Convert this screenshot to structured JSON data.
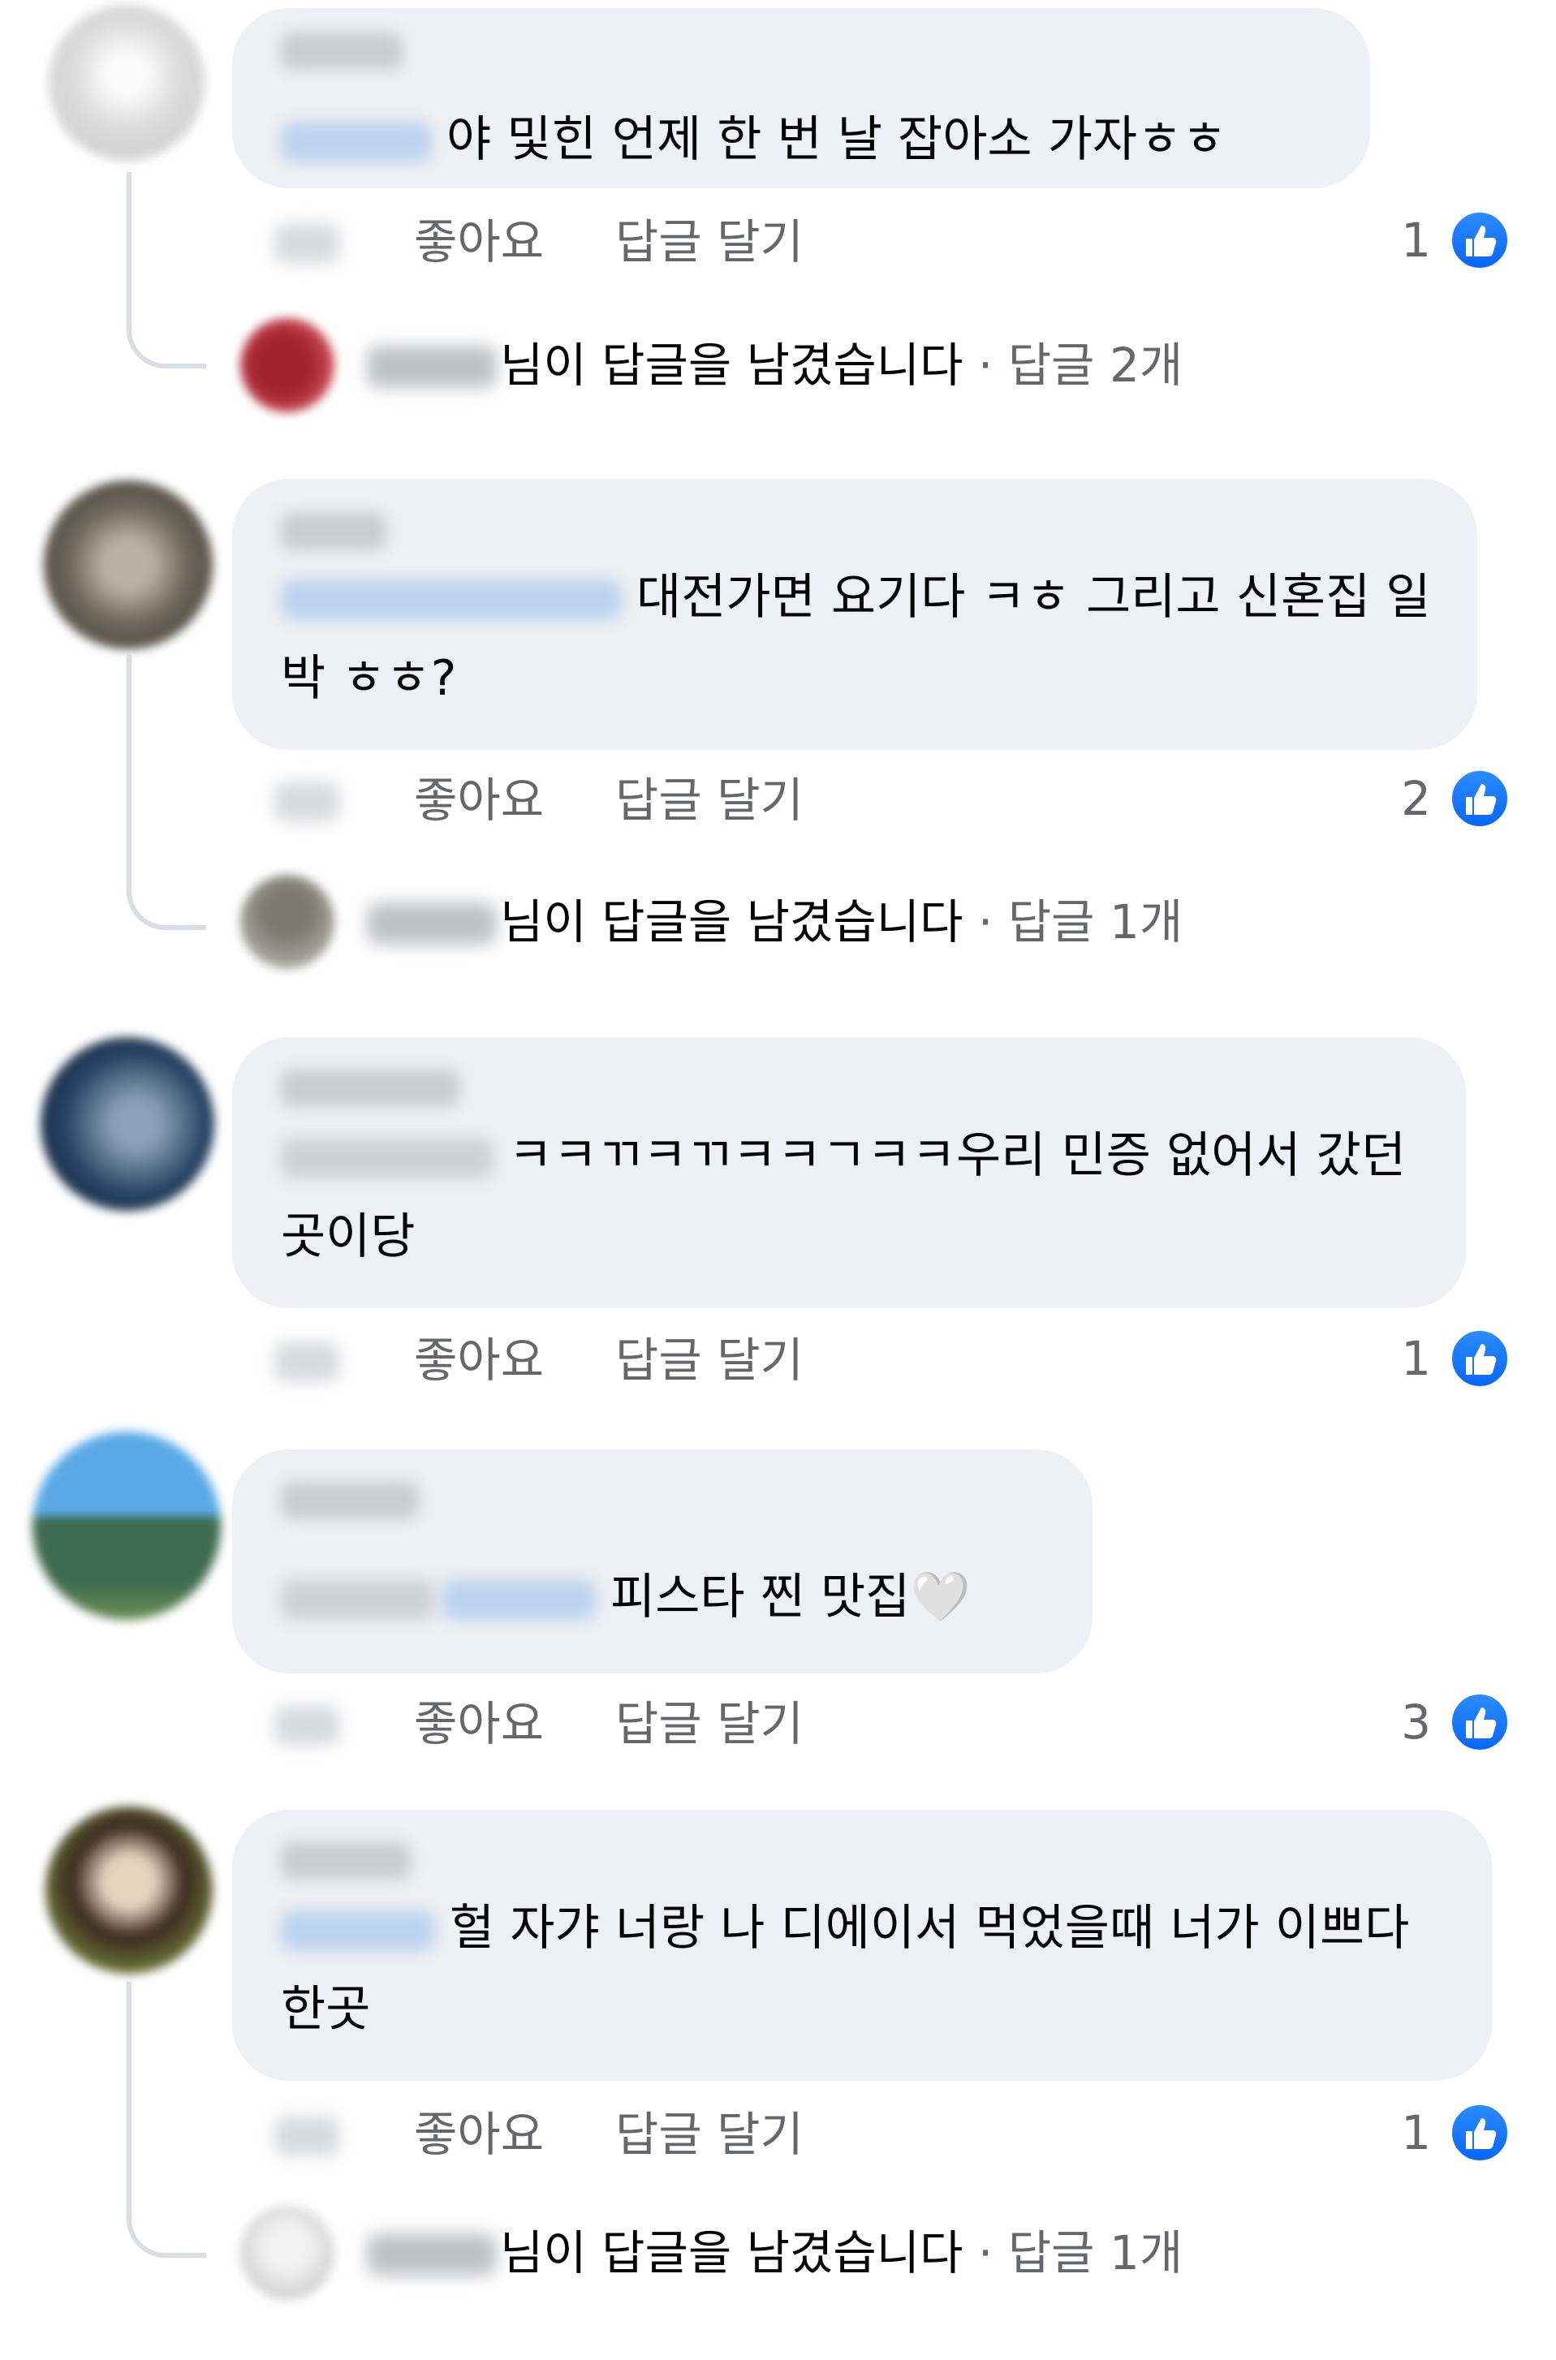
{
  "actions": {
    "like_label": "좋아요",
    "reply_label": "답글 달기"
  },
  "colors": {
    "bubble": "#eff0f3",
    "secondary_text": "#65676b",
    "like_blue": "#0866ff"
  },
  "icons": {
    "reaction": "thumbs-up-icon"
  },
  "comments": [
    {
      "text": "야 및힌 언제 한 번 날 잡아소 가자ㅎㅎ",
      "reaction_count": "1",
      "replies": {
        "text": "님이 답글을 남겼습니다",
        "separator": " · ",
        "count": "답글 2개"
      }
    },
    {
      "text": "대전가면 요기다 ㅋㅎ 그리고 신혼집 일박 ㅎㅎ?",
      "reaction_count": "2",
      "replies": {
        "text": "님이 답글을 남겼습니다",
        "separator": " · ",
        "count": "답글 1개"
      }
    },
    {
      "text": "ㅋㅋㄲㅋㄲㅋㅋㄱㅋㅋ우리 민증 없어서 갔던 곳이당",
      "reaction_count": "1"
    },
    {
      "text": "피스타 찐 맛집🤍",
      "reaction_count": "3"
    },
    {
      "text": "헐 자갸 너랑 나 디에이서 먹었을때 너가 이쁘다 한곳",
      "reaction_count": "1",
      "replies": {
        "text": "님이 답글을 남겼습니다",
        "separator": " · ",
        "count": "답글 1개"
      }
    }
  ]
}
